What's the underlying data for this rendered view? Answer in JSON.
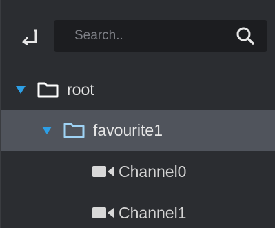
{
  "search": {
    "placeholder": "Search..",
    "value": ""
  },
  "icons": {
    "back": "back-arrow-icon",
    "search": "magnifier-icon",
    "expand": "caret-down-icon",
    "folder": "folder-icon",
    "camera": "video-camera-icon"
  },
  "colors": {
    "accent": "#2d9fe6",
    "selected_row": "#50545c",
    "background": "#2b2d31",
    "search_bg": "#1c1d20"
  },
  "tree": {
    "root": {
      "label": "root",
      "expanded": true
    },
    "group": {
      "label": "favourite1",
      "expanded": true,
      "selected": true
    },
    "channels": [
      {
        "label": "Channel0"
      },
      {
        "label": "Channel1"
      }
    ]
  }
}
